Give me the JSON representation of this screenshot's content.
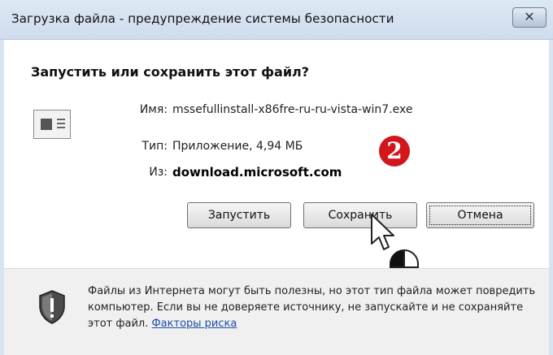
{
  "window": {
    "title": "Загрузка файла - предупреждение системы безопасности",
    "close_label": "✕"
  },
  "dialog": {
    "question": "Запустить или сохранить этот файл?",
    "file_icon": "application-file-icon",
    "fields": {
      "name_label": "Имя:",
      "name_value": "mssefullinstall-x86fre-ru-ru-vista-win7.exe",
      "type_label": "Тип:",
      "type_value": "Приложение, 4,94 МБ",
      "from_label": "Из:",
      "from_value": "download.microsoft.com"
    },
    "annotation_marker": "2",
    "buttons": {
      "run": "Запустить",
      "save": "Сохранить",
      "cancel": "Отмена"
    }
  },
  "footer": {
    "icon": "shield-warning-icon",
    "warning_text": "Файлы из Интернета могут быть полезны, но этот тип файла может повредить компьютер. Если вы не доверяете источнику, не запускайте и не сохраняйте этот файл.",
    "risk_link": "Факторы риска"
  },
  "colors": {
    "titlebar": "#cfdced",
    "marker": "#d3161c",
    "link": "#1f4ea5"
  }
}
